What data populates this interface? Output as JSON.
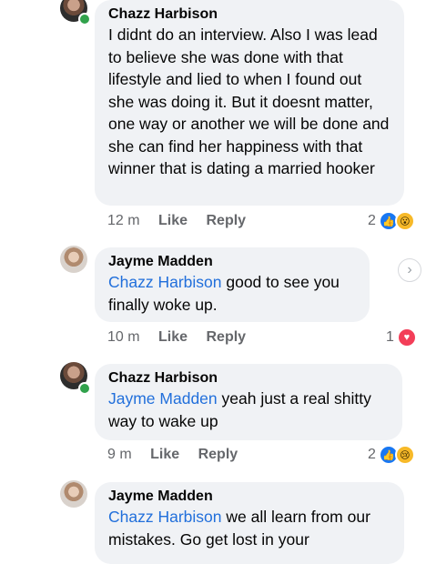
{
  "comments": [
    {
      "name": "Chazz Harbison",
      "mention": "",
      "text": "I didnt do an interview.  Also I was lead to believe she was done with that lifestyle and lied to when I found out she was doing it. But it doesnt matter, one way or another we will be done and she can find her happiness with that winner that is dating a married hooker",
      "time": "12 m",
      "like": "Like",
      "reply": "Reply",
      "reaction_count": "2",
      "reaction_icons": [
        "like-icon",
        "wow-icon"
      ]
    },
    {
      "name": "Jayme Madden",
      "mention": "Chazz Harbison",
      "text": " good to see you finally woke up.",
      "time": "10 m",
      "like": "Like",
      "reply": "Reply",
      "reaction_count": "1",
      "reaction_icons": [
        "love-icon"
      ]
    },
    {
      "name": "Chazz Harbison",
      "mention": "Jayme Madden",
      "text": " yeah just a real shitty way to wake up",
      "time": "9 m",
      "like": "Like",
      "reply": "Reply",
      "reaction_count": "2",
      "reaction_icons": [
        "like-icon",
        "sad-icon"
      ]
    },
    {
      "name": "Jayme Madden",
      "mention": "Chazz Harbison",
      "text": " we all learn from our mistakes. Go get lost in your"
    }
  ]
}
